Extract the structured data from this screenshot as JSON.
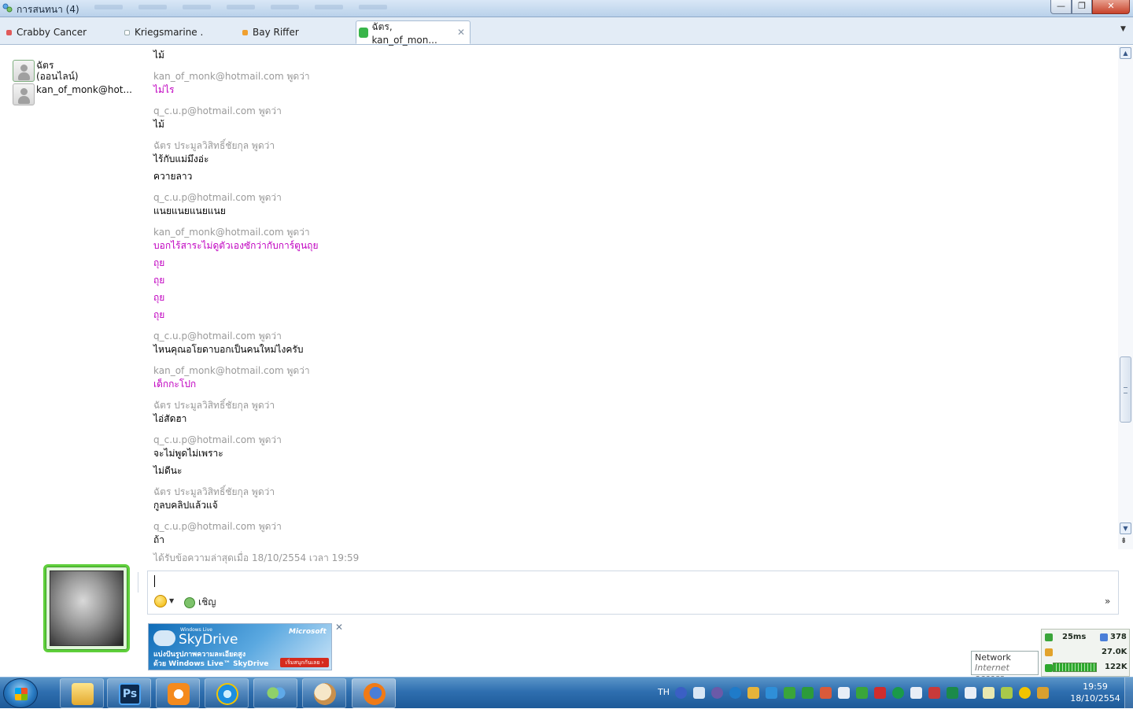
{
  "window": {
    "title": "การสนทนา (4)",
    "buttons": {
      "minimize": "—",
      "maximize": "❐",
      "close": "✕"
    }
  },
  "tabs": [
    {
      "label": "Crabby Cancer",
      "active": false,
      "status_color": "#e05a5a"
    },
    {
      "label": "Kriegsmarine .",
      "active": false,
      "status_color": "#ffffff"
    },
    {
      "label": "Bay Riffer",
      "active": false,
      "status_color": "#f0a030"
    },
    {
      "label": "ฉัตร, kan_of_mon...",
      "active": true,
      "status_color": "#39b54a",
      "close": "✕"
    }
  ],
  "participants": [
    {
      "name": "ฉัตร",
      "status": "(ออนไลน์)",
      "icon": "contact-online-icon"
    },
    {
      "name": "kan_of_monk@hot...",
      "status": "",
      "icon": "contact-offline-icon"
    }
  ],
  "conversation": [
    {
      "type": "message",
      "style": "normal",
      "text": "ไม้"
    },
    {
      "type": "sender",
      "text": "kan_of_monk@hotmail.com พูดว่า"
    },
    {
      "type": "message",
      "style": "pink",
      "text": "ไม่ไร"
    },
    {
      "type": "sender",
      "text": "q_c.u.p@hotmail.com พูดว่า"
    },
    {
      "type": "message",
      "style": "normal",
      "text": "ไม้"
    },
    {
      "type": "sender",
      "text": "ฉัตร ประมูลวิสิทธิ์ชัยกุล พูดว่า"
    },
    {
      "type": "message",
      "style": "normal",
      "text": "ไร้กับแม่มึงอ่ะ"
    },
    {
      "type": "message",
      "style": "normal",
      "text": "ควายลาว"
    },
    {
      "type": "sender",
      "text": "q_c.u.p@hotmail.com พูดว่า"
    },
    {
      "type": "message",
      "style": "normal",
      "text": "แนยแนยแนยแนย"
    },
    {
      "type": "sender",
      "text": "kan_of_monk@hotmail.com พูดว่า"
    },
    {
      "type": "message",
      "style": "pink",
      "text": "บอกไร้สาระไม่ดูตัวเองซักว่ากับการ์ตูนถุย"
    },
    {
      "type": "message",
      "style": "pink",
      "text": "ถุย"
    },
    {
      "type": "message",
      "style": "pink",
      "text": "ถุย"
    },
    {
      "type": "message",
      "style": "pink",
      "text": "ถุย"
    },
    {
      "type": "message",
      "style": "pink",
      "text": "ถุย"
    },
    {
      "type": "sender",
      "text": "q_c.u.p@hotmail.com พูดว่า"
    },
    {
      "type": "message",
      "style": "normal",
      "text": "ไหนคุณอโยดาบอกเป็นคนใหม่ไงครับ"
    },
    {
      "type": "sender",
      "text": "kan_of_monk@hotmail.com พูดว่า"
    },
    {
      "type": "message",
      "style": "pink",
      "text": "เด็กกะโปก"
    },
    {
      "type": "sender",
      "text": "ฉัตร ประมูลวิสิทธิ์ชัยกุล พูดว่า"
    },
    {
      "type": "message",
      "style": "normal",
      "text": "ไอ่สัดฮา"
    },
    {
      "type": "sender",
      "text": "q_c.u.p@hotmail.com พูดว่า"
    },
    {
      "type": "message",
      "style": "normal",
      "text": "จะไม่พูดไม่เพราะ"
    },
    {
      "type": "message",
      "style": "normal",
      "text": "ไม่ดีนะ"
    },
    {
      "type": "sender",
      "text": "ฉัตร ประมูลวิสิทธิ์ชัยกุล พูดว่า"
    },
    {
      "type": "message",
      "style": "normal",
      "text": "กูลบคลิปแล้วแจ้"
    },
    {
      "type": "sender",
      "text": "q_c.u.p@hotmail.com พูดว่า"
    },
    {
      "type": "message",
      "style": "normal",
      "text": "ถ้า"
    }
  ],
  "last_received": "ได้รับข้อความล่าสุดเมื่อ 18/10/2554 เวลา 19:59",
  "composer": {
    "invite_label": "เชิญ",
    "more": "»",
    "emoticon_icon": "smiley-icon",
    "invite_icon": "invite-contact-icon"
  },
  "ad": {
    "brand_small": "Windows Live",
    "brand_ms": "Microsoft",
    "product": "SkyDrive",
    "line1": "แบ่งปันรูปภาพความละเอียดสูง",
    "line2": "ด้วย Windows Live™ SkyDrive",
    "cta": "เริ่มสนุกกันเลย ›",
    "close": "✕"
  },
  "network_tooltip": {
    "title": "Network",
    "subtitle": "Internet access"
  },
  "gadget": {
    "ping": "25ms",
    "count": "378",
    "upload": "27.0K",
    "download": "122K"
  },
  "taskbar": {
    "lang": "TH",
    "clock_time": "19:59",
    "clock_date": "18/10/2554",
    "apps": [
      "explorer-icon",
      "photoshop-icon",
      "media-player-icon",
      "internet-explorer-icon",
      "messenger-icon",
      "paint-icon",
      "firefox-icon"
    ],
    "photoshop_label": "Ps"
  },
  "colors": {
    "accent": "#2f6fb0",
    "sender_gray": "#9a9a9a",
    "pink_text": "#c000c0",
    "avatar_frame": "#5fcf3b"
  }
}
